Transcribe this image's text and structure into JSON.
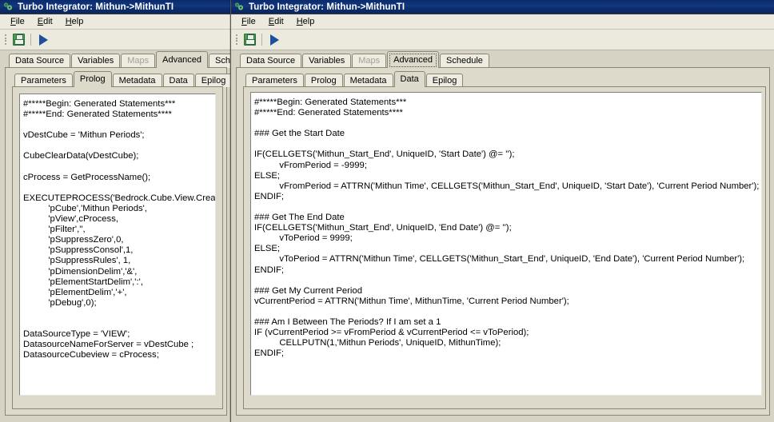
{
  "windows": [
    {
      "id": "left",
      "title": "Turbo Integrator:  Mithun->MithunTI",
      "app_icon": "gears-icon",
      "menu": [
        {
          "label": "File",
          "accel": "F"
        },
        {
          "label": "Edit",
          "accel": "E"
        },
        {
          "label": "Help",
          "accel": "H"
        }
      ],
      "toolbar": {
        "save_label": "save-icon",
        "run_label": "run-icon"
      },
      "outer_tabs": [
        {
          "label": "Data Source",
          "state": "normal"
        },
        {
          "label": "Variables",
          "state": "normal"
        },
        {
          "label": "Maps",
          "state": "disabled"
        },
        {
          "label": "Advanced",
          "state": "selected"
        },
        {
          "label": "Schedu",
          "state": "normal"
        }
      ],
      "inner_tabs": [
        {
          "label": "Parameters",
          "state": "normal"
        },
        {
          "label": "Prolog",
          "state": "selected"
        },
        {
          "label": "Metadata",
          "state": "normal"
        },
        {
          "label": "Data",
          "state": "normal"
        },
        {
          "label": "Epilog",
          "state": "normal"
        }
      ],
      "code": "#*****Begin: Generated Statements***\n#*****End: Generated Statements****\n\nvDestCube = 'Mithun Periods';\n\nCubeClearData(vDestCube);\n\ncProcess = GetProcessName();\n\nEXECUTEPROCESS('Bedrock.Cube.View.Create',\n          'pCube','Mithun Periods',\n          'pView',cProcess,\n          'pFilter','',\n          'pSuppressZero',0,\n          'pSuppressConsol',1,\n          'pSuppressRules', 1,\n          'pDimensionDelim','&',\n          'pElementStartDelim',':',\n          'pElementDelim','+',\n          'pDebug',0);\n\n\nDataSourceType = 'VIEW';\nDatasourceNameForServer = vDestCube ;\nDatasourceCubeview = cProcess;"
    },
    {
      "id": "right",
      "title": "Turbo Integrator:  Mithun->MithunTI",
      "app_icon": "gears-icon",
      "menu": [
        {
          "label": "File",
          "accel": "F"
        },
        {
          "label": "Edit",
          "accel": "E"
        },
        {
          "label": "Help",
          "accel": "H"
        }
      ],
      "toolbar": {
        "save_label": "save-icon",
        "run_label": "run-icon"
      },
      "outer_tabs": [
        {
          "label": "Data Source",
          "state": "normal"
        },
        {
          "label": "Variables",
          "state": "normal"
        },
        {
          "label": "Maps",
          "state": "disabled"
        },
        {
          "label": "Advanced",
          "state": "selected-focused"
        },
        {
          "label": "Schedule",
          "state": "normal"
        }
      ],
      "inner_tabs": [
        {
          "label": "Parameters",
          "state": "normal"
        },
        {
          "label": "Prolog",
          "state": "normal"
        },
        {
          "label": "Metadata",
          "state": "normal"
        },
        {
          "label": "Data",
          "state": "selected"
        },
        {
          "label": "Epilog",
          "state": "normal"
        }
      ],
      "code": "#*****Begin: Generated Statements***\n#*****End: Generated Statements****\n\n### Get the Start Date\n\nIF(CELLGETS('Mithun_Start_End', UniqueID, 'Start Date') @= '');\n          vFromPeriod = -9999;\nELSE;\n          vFromPeriod = ATTRN('Mithun Time', CELLGETS('Mithun_Start_End', UniqueID, 'Start Date'), 'Current Period Number');\nENDIF;\n\n### Get The End Date\nIF(CELLGETS('Mithun_Start_End', UniqueID, 'End Date') @= '');\n          vToPeriod = 9999;\nELSE;\n          vToPeriod = ATTRN('Mithun Time', CELLGETS('Mithun_Start_End', UniqueID, 'End Date'), 'Current Period Number');\nENDIF;\n\n### Get My Current Period\nvCurrentPeriod = ATTRN('Mithun Time', MithunTime, 'Current Period Number');\n\n### Am I Between The Periods? If I am set a 1\nIF (vCurrentPeriod >= vFromPeriod & vCurrentPeriod <= vToPeriod);\n          CELLPUTN(1,'Mithun Periods', UniqueID, MithunTime);\nENDIF;"
    }
  ],
  "colors": {
    "titlebar": "#0d2e6e",
    "face": "#d6d2c4",
    "tab_face": "#eeebe1",
    "tab_selected": "#ddd9cb",
    "editor_bg": "#ffffff",
    "save_green": "#4e9b56",
    "run_blue": "#1d4f9e",
    "border": "#8b8573"
  }
}
